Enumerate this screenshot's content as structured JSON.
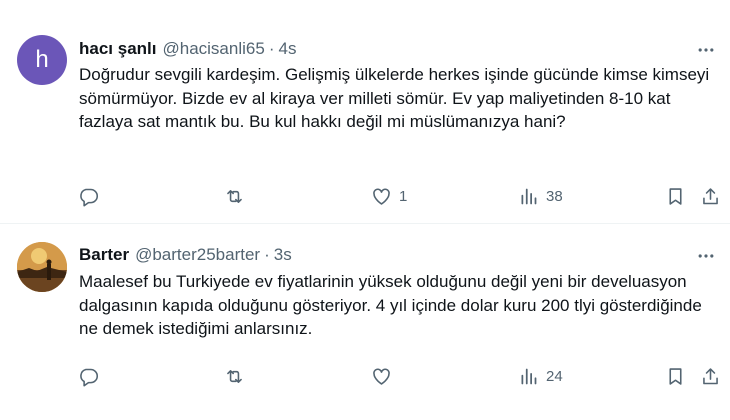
{
  "tweets": [
    {
      "author_name": "hacı şanlı",
      "handle": "@hacisanli65",
      "separator": "·",
      "time": "4s",
      "avatar_letter": "h",
      "avatar_color": "#6b56b8",
      "text": "Doğrudur sevgili kardeşim. Gelişmiş ülkelerde herkes işinde gücünde kimse kimseyi sömürmüyor. Bizde ev al kiraya ver milleti sömür. Ev yap maliyetinden 8-10 kat fazlaya sat mantık bu. Bu kul hakkı değil mi müslümanızya hani?",
      "actions": {
        "replies": "",
        "retweets": "",
        "likes": "1",
        "views": "38"
      }
    },
    {
      "author_name": "Barter",
      "handle": "@barter25barter",
      "separator": "·",
      "time": "3s",
      "text": "Maalesef bu Turkiyede ev fiyatlarinin yüksek olduğunu değil yeni bir develuasyon dalgasının kapıda olduğunu gösteriyor. 4 yıl içinde dolar kuru 200 tlyi gösterdiğinde ne demek istediğimi anlarsınız.",
      "actions": {
        "replies": "",
        "retweets": "",
        "likes": "",
        "views": "24"
      }
    }
  ],
  "icons": [
    "more-icon",
    "reply-icon",
    "retweet-icon",
    "like-icon",
    "views-icon",
    "bookmark-icon",
    "share-icon"
  ],
  "colors": {
    "text": "#0f1419",
    "secondary": "#536471",
    "divider": "#eff3f4"
  }
}
